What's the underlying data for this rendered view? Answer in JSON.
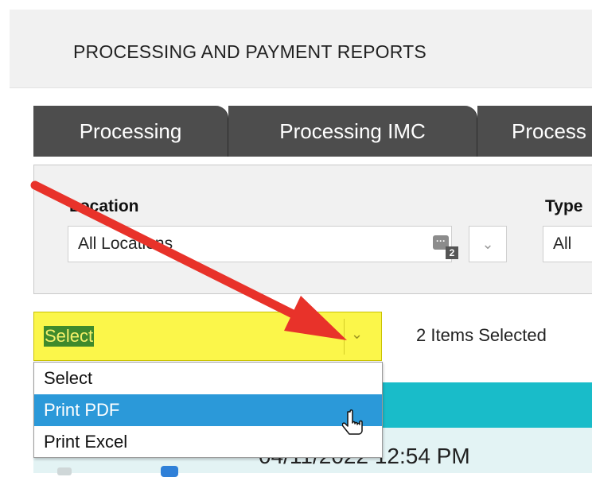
{
  "header": {
    "title": "PROCESSING AND PAYMENT REPORTS"
  },
  "tabs": [
    {
      "label": "Processing"
    },
    {
      "label": "Processing IMC"
    },
    {
      "label": "Process"
    }
  ],
  "filters": {
    "location": {
      "label": "Location",
      "value": "All Locations",
      "badge": "···",
      "count": "2"
    },
    "type": {
      "label": "Type",
      "value": "All"
    }
  },
  "export_select": {
    "value": "Select",
    "options": [
      {
        "label": "Select"
      },
      {
        "label": "Print PDF",
        "highlighted": true
      },
      {
        "label": "Print Excel"
      }
    ]
  },
  "selection_status": "2 Items Selected",
  "table": {
    "first_row_date": "04/11/2022 12:54 PM"
  },
  "colors": {
    "tab_bg": "#4d4d4d",
    "select_highlight": "#fbf64a",
    "selected_text_bg": "#3f8a2c",
    "option_hover": "#2b99d9",
    "table_header": "#19bcc9",
    "annotation_arrow": "#e8322a"
  }
}
